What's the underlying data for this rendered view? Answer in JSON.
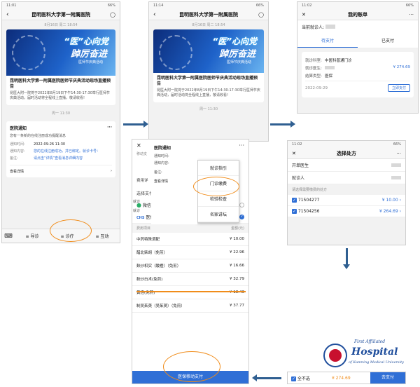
{
  "hospital_title": "昆明医科大学第一附属医院",
  "status": {
    "time1": "11:01",
    "time2": "11:14",
    "time3": "11:02",
    "time4": "11:02",
    "battery": "66%"
  },
  "article": {
    "date": "8月16日 周二 18:54",
    "banner_line1": "“医”心向党",
    "banner_line2": "踔厉奋进",
    "banner_line3": "医师节庆典活动",
    "title": "昆明医科大学第一附属医院医师节庆典活动现场直播预告",
    "desc": "昆医大附一院将于2022年8月19日下午14:30-17:30举行医师节庆典活动，届时活动将全程线上直播，敬请收看!"
  },
  "week_line": "周一 11:30",
  "notice": {
    "title": "医院通知",
    "more": "···",
    "sub": "您有一条新的在线注册成功提醒消息",
    "time_label": "通知时间:",
    "time_value": "2022-09-26 11:30",
    "content_label": "通知内容:",
    "content_value": "您的在线注册成功，并已绑定。就诊卡号：",
    "remark_label": "备注:",
    "remark_value": "请点击“详情”查看消息详细内容",
    "detail": "查看详情",
    "chevron": "›"
  },
  "tabbar": {
    "keyboard": "⌨",
    "guide": "≡ 导诊",
    "clinic": "≡ 诊疗",
    "interact": "≡ 互动"
  },
  "popup_menu": [
    "就诊指引",
    "门诊缴费",
    "检验检查",
    "名家讲坛"
  ],
  "bill": {
    "nav_title": "我的账单",
    "close": "✕",
    "more": "···",
    "current_patient_label": "当前就诊人:",
    "tabs": [
      "待支付",
      "已支付"
    ],
    "dept_label": "就诊科室:",
    "dept_value": "中医科普通门诊",
    "doctor_label": "就诊医生:",
    "type_label": "结算类型:",
    "type_value": "医保",
    "amount": "¥ 274.69",
    "date": "2022-09-29",
    "pay_button": "立即支付"
  },
  "select": {
    "nav_title": "选择处方",
    "doctor_label": "开单医生",
    "patient_label": "就诊人",
    "hint": "请选择需要缴费的处方",
    "items": [
      {
        "code": "71504277",
        "amount": "¥ 10.00"
      },
      {
        "code": "71504256",
        "amount": "¥ 264.69"
      }
    ],
    "all_unselect": "全不选",
    "total": "¥ 274.69",
    "go_pay": "去支付"
  },
  "pay": {
    "section_label": "选择支付",
    "wechat": "微信支付",
    "insurance": "医保移动支付",
    "insurance_short": "移动支",
    "col_item": "费用项目",
    "col_amount": "金额(元)",
    "fee_label": "费用详",
    "items": [
      {
        "name": "中药特殊调配",
        "amount": "¥ 10.00"
      },
      {
        "name": "醋北柴胡（免煎）",
        "amount": "¥ 22.96"
      },
      {
        "name": "麸炒枳实（酸橙）（免煎）",
        "amount": "¥ 16.66"
      },
      {
        "name": "麸炒白术(免煎)",
        "amount": "¥ 32.79"
      },
      {
        "name": "黄连(免煎)",
        "amount": "¥ 18.43"
      },
      {
        "name": "制吴茱萸（吴茱萸）（免煎）",
        "amount": "¥ 37.77"
      }
    ],
    "pay_button": "医保移动支付",
    "left_labels": [
      "就诊",
      "就诊"
    ]
  },
  "logo": {
    "line1": "First Affiliated",
    "line2": "Hospital",
    "line3": "of Kunming Medical University"
  },
  "colors": {
    "accent": "#2f6fd6",
    "highlight": "#f08c1a",
    "arrow": "#2f5f91"
  }
}
